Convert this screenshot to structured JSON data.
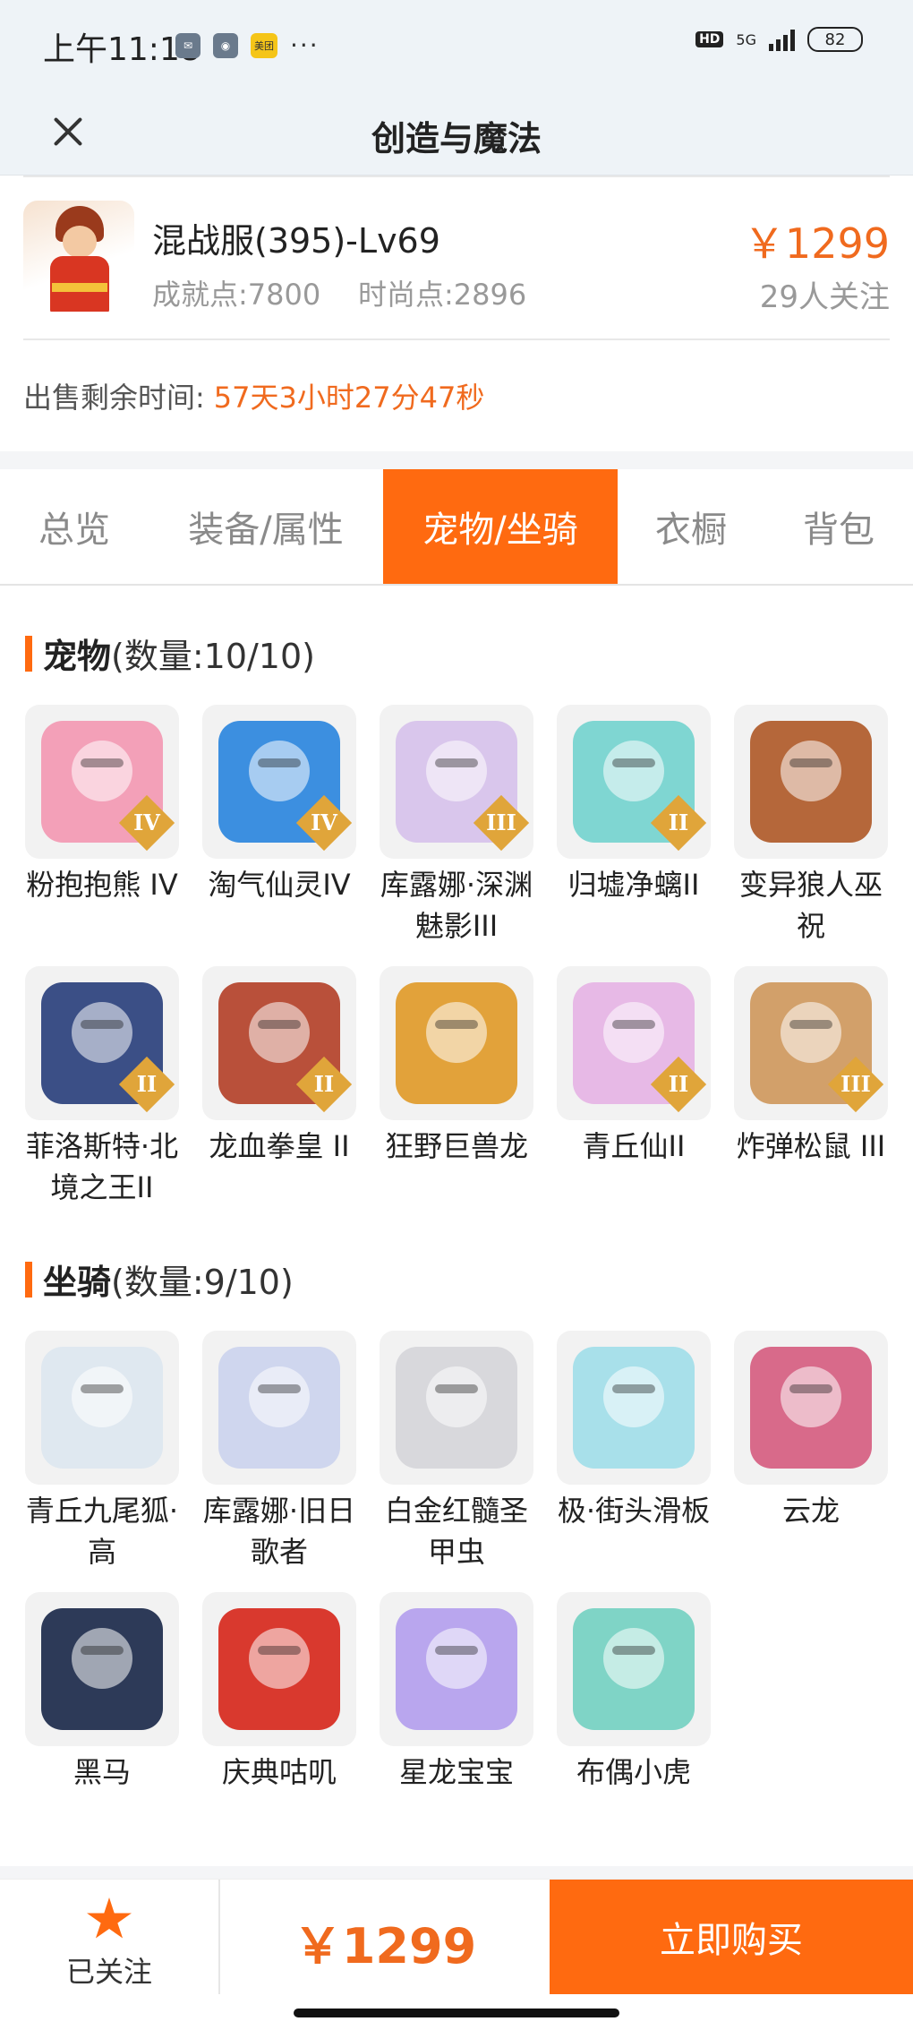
{
  "status_bar": {
    "time": "上午11:18",
    "icons": [
      "mail-icon",
      "app-icon",
      "美团"
    ],
    "network": "5G",
    "hd": "HD",
    "battery": "82"
  },
  "nav": {
    "title": "创造与魔法"
  },
  "product": {
    "name": "混战服(395)-Lv69",
    "achievement": "成就点:7800",
    "fashion": "时尚点:2896",
    "price": "￥1299",
    "followers": "29人关注"
  },
  "remaining": {
    "label": "出售剩余时间:",
    "value": "57天3小时27分47秒"
  },
  "tabs": [
    "总览",
    "装备/属性",
    "宠物/坐骑",
    "衣橱",
    "背包"
  ],
  "active_tab": "宠物/坐骑",
  "pets": {
    "title": "宠物",
    "count": "(数量:10/10)",
    "items": [
      {
        "name": "粉抱抱熊 IV",
        "badge": "IV",
        "color": "#f3a0b8"
      },
      {
        "name": "淘气仙灵IV",
        "badge": "IV",
        "color": "#3c8fe0"
      },
      {
        "name": "库露娜·深渊魅影III",
        "badge": "III",
        "color": "#d9c6ec"
      },
      {
        "name": "归墟净螭II",
        "badge": "II",
        "color": "#7fd6d2"
      },
      {
        "name": "变异狼人巫祝",
        "badge": "",
        "color": "#b5673a"
      },
      {
        "name": "菲洛斯特·北境之王II",
        "badge": "II",
        "color": "#3b4f86"
      },
      {
        "name": "龙血拳皇 II",
        "badge": "II",
        "color": "#b9503a"
      },
      {
        "name": "狂野巨兽龙",
        "badge": "",
        "color": "#e2a23a"
      },
      {
        "name": "青丘仙II",
        "badge": "II",
        "color": "#e7b9e6"
      },
      {
        "name": "炸弹松鼠 III",
        "badge": "III",
        "color": "#d2a06a"
      }
    ]
  },
  "mounts": {
    "title": "坐骑",
    "count": "(数量:9/10)",
    "items": [
      {
        "name": "青丘九尾狐·高",
        "color": "#dfe8f0"
      },
      {
        "name": "库露娜·旧日歌者",
        "color": "#cfd6ee"
      },
      {
        "name": "白金红髓圣甲虫",
        "color": "#d8d8dc"
      },
      {
        "name": "极·街头滑板",
        "color": "#a8e0ea"
      },
      {
        "name": "云龙",
        "color": "#d86a8a"
      },
      {
        "name": "黑马",
        "color": "#2d3a58"
      },
      {
        "name": "庆典咕叽",
        "color": "#d9392e"
      },
      {
        "name": "星龙宝宝",
        "color": "#b9a6ee"
      },
      {
        "name": "布偶小虎",
        "color": "#7fd4c6"
      }
    ]
  },
  "bottom": {
    "follow_label": "已关注",
    "price": "￥1299",
    "buy_label": "立即购买"
  },
  "colors": {
    "accent": "#ff6a10",
    "price": "#f06a1e"
  }
}
